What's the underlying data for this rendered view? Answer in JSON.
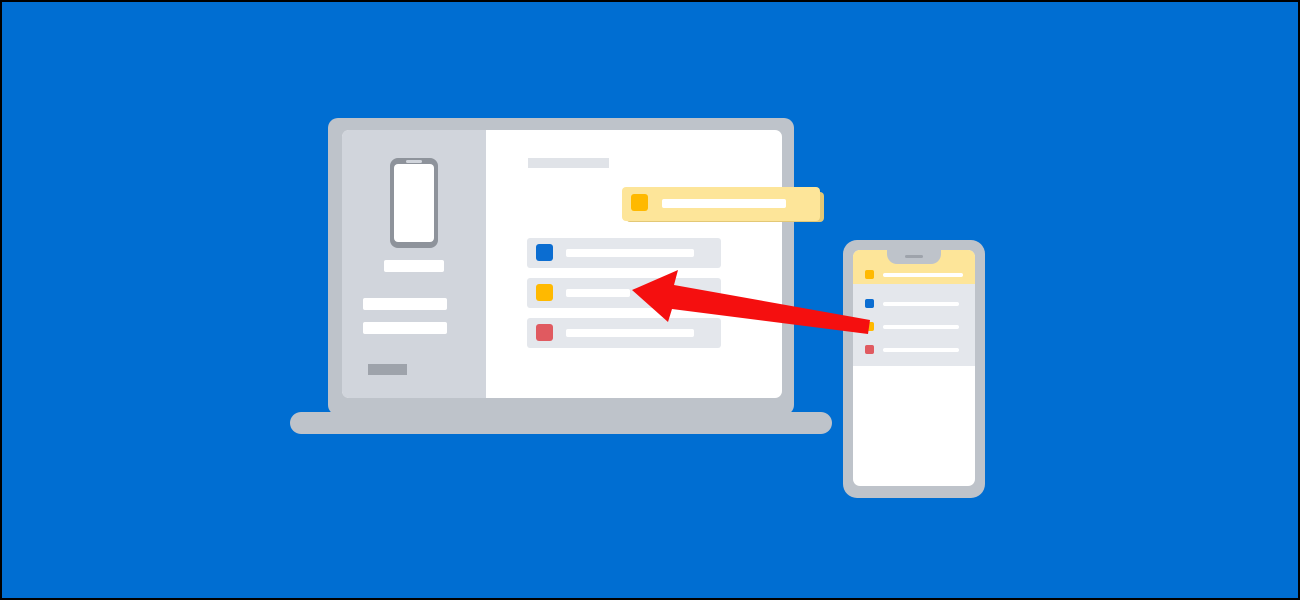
{
  "colors": {
    "background": "#006ed2",
    "device_frame": "#bec3ca",
    "sidebar": "#d1d5dc",
    "screen": "#ffffff",
    "row": "#e4e7ec",
    "heading_bar": "#e0e3e8",
    "button_bar": "#9ea3ab",
    "highlight": "#fde599",
    "highlight_shadow": "#e3c876",
    "arrow": "#f50f0f"
  },
  "laptop": {
    "list_markers": [
      {
        "name": "blue-square-icon",
        "color": "#0b6dd1"
      },
      {
        "name": "yellow-square-icon",
        "color": "#ffb900"
      },
      {
        "name": "red-square-icon",
        "color": "#e05a60"
      }
    ],
    "floating_card_marker": {
      "name": "yellow-square-icon",
      "color": "#ffb900"
    }
  },
  "phone": {
    "markers": [
      {
        "name": "yellow-square-icon",
        "color": "#ffb900"
      },
      {
        "name": "blue-square-icon",
        "color": "#0b6dd1"
      },
      {
        "name": "yellow-square-icon",
        "color": "#ffb900"
      },
      {
        "name": "red-square-icon",
        "color": "#e05a60"
      }
    ]
  },
  "arrow": {
    "name": "drag-arrow-icon"
  }
}
